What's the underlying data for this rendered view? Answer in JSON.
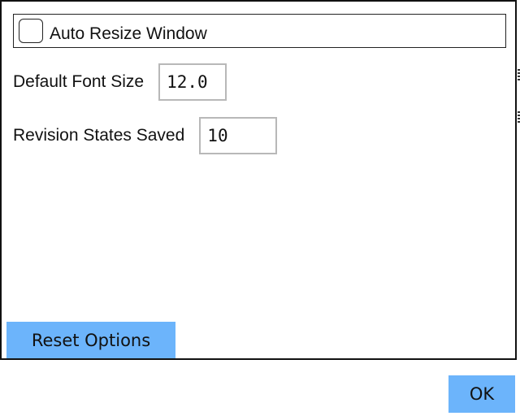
{
  "options": {
    "auto_resize": {
      "label": "Auto Resize Window",
      "checked": false
    },
    "default_font_size": {
      "label": "Default Font Size",
      "value": "12.0"
    },
    "revision_states": {
      "label": "Revision States Saved",
      "value": "10"
    }
  },
  "buttons": {
    "reset_label": "Reset Options",
    "ok_label": "OK"
  },
  "colors": {
    "button_bg": "#6cb4fb",
    "input_border": "#b8b8b8"
  }
}
